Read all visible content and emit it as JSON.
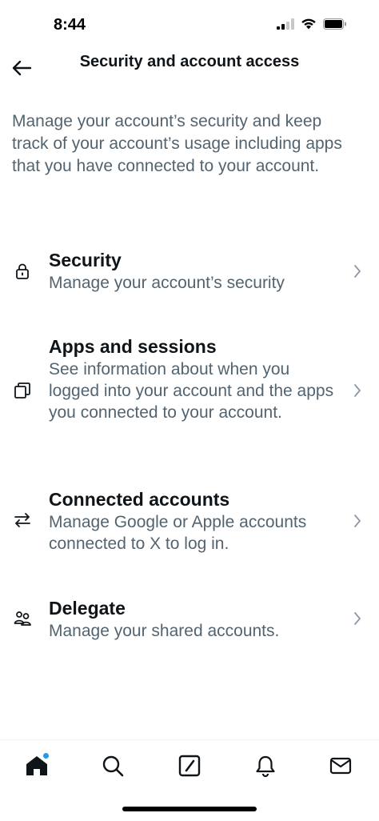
{
  "status_bar": {
    "time": "8:44"
  },
  "header": {
    "title": "Security and account access",
    "back_icon": "arrow-left-icon"
  },
  "intro": {
    "text": "Manage your account’s security and keep track of your account’s usage including apps that you have connected to your account."
  },
  "items": [
    {
      "title": "Security",
      "description": "Manage your account’s security",
      "icon": "lock-icon"
    },
    {
      "title": "Apps and sessions",
      "description": "See information about when you logged into your account and the apps you connected to your account.",
      "icon": "apps-icon"
    },
    {
      "title": "Connected accounts",
      "description": "Manage Google or Apple accounts connected to X to log in.",
      "icon": "arrows-exchange-icon"
    },
    {
      "title": "Delegate",
      "description": "Manage your shared accounts.",
      "icon": "people-icon"
    }
  ],
  "tab_bar": {
    "tabs": [
      {
        "name": "home",
        "icon": "home-icon",
        "active": true
      },
      {
        "name": "search",
        "icon": "search-icon",
        "active": false
      },
      {
        "name": "grok",
        "icon": "grok-icon",
        "active": false
      },
      {
        "name": "notifications",
        "icon": "bell-icon",
        "active": false
      },
      {
        "name": "messages",
        "icon": "mail-icon",
        "active": false
      }
    ]
  },
  "colors": {
    "primary_text": "#0f1419",
    "secondary_text": "#536471",
    "accent": "#1d9bf0",
    "chevron": "#8b98a5"
  }
}
